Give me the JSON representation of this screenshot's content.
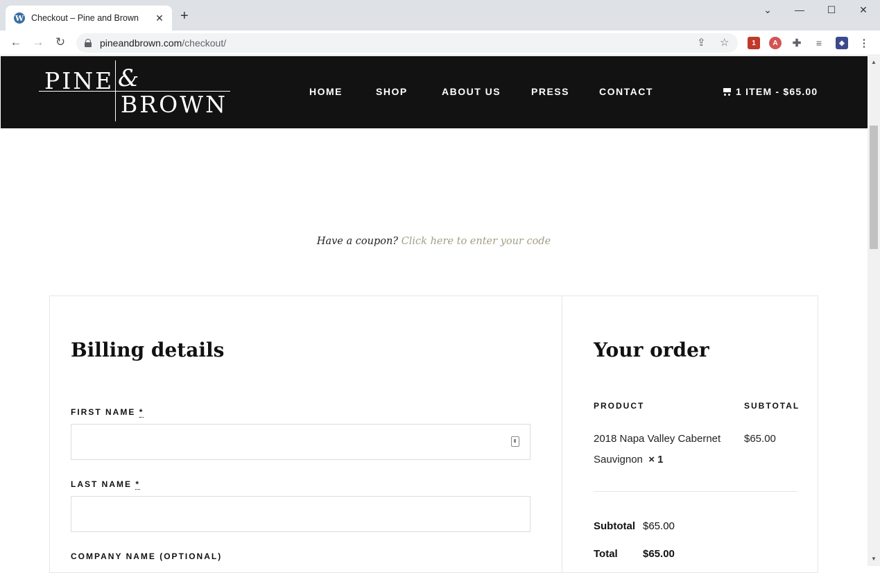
{
  "browser": {
    "tab_title": "Checkout – Pine and Brown",
    "tab_favicon": "W",
    "url_domain": "pineandbrown.com",
    "url_path": "/checkout/",
    "extension_badge": "1"
  },
  "header": {
    "logo_line1": "PINE",
    "logo_amp": "&",
    "logo_line2": "BROWN",
    "nav": [
      "HOME",
      "SHOP",
      "ABOUT US",
      "PRESS",
      "CONTACT"
    ],
    "cart": "1 ITEM - $65.00"
  },
  "coupon": {
    "prompt": "Have a coupon?",
    "link": "Click here to enter your code"
  },
  "billing": {
    "title": "Billing details",
    "first_name_label": "FIRST NAME",
    "last_name_label": "LAST NAME",
    "company_label": "COMPANY NAME (OPTIONAL)",
    "required_mark": "*",
    "first_name_value": "",
    "last_name_value": ""
  },
  "order": {
    "title": "Your order",
    "col_product": "PRODUCT",
    "col_subtotal": "SUBTOTAL",
    "product_name": "2018 Napa Valley Cabernet Sauvignon",
    "product_qty": "× 1",
    "product_price": "$65.00",
    "subtotal_label": "Subtotal",
    "subtotal_value": "$65.00",
    "total_label": "Total",
    "total_value": "$65.00"
  },
  "colors": {
    "header_bg": "#121212",
    "link": "#a39e86"
  }
}
